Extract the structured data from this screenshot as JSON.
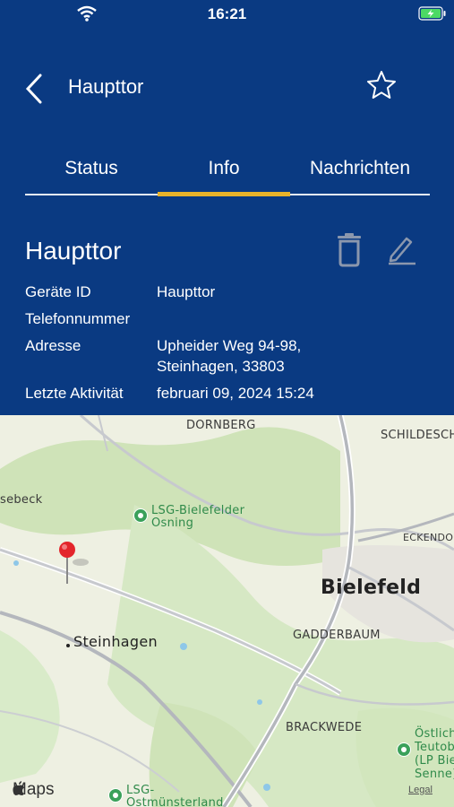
{
  "status_bar": {
    "time": "16:21",
    "icons": [
      "wifi-icon",
      "battery-charging-icon"
    ],
    "battery_color": "#4cd964"
  },
  "header": {
    "title": "Haupttor",
    "back_icon": "chevron-left-icon",
    "favorite_icon": "star-outline-icon"
  },
  "tabs": [
    {
      "label": "Status",
      "active": false
    },
    {
      "label": "Info",
      "active": true
    },
    {
      "label": "Nachrichten",
      "active": false
    }
  ],
  "colors": {
    "primary": "#0a3a82",
    "accent": "#e9b32a"
  },
  "device": {
    "name": "Haupttor",
    "actions": [
      "delete-icon",
      "edit-icon"
    ],
    "fields": [
      {
        "label": "Geräte ID",
        "value": "Haupttor"
      },
      {
        "label": "Telefonnummer",
        "value": ""
      },
      {
        "label": "Adresse",
        "value_line1": "Upheider Weg 94-98,",
        "value_line2": "Steinhagen, 33803"
      },
      {
        "label": "Letzte Aktivität",
        "value": "februari 09, 2024 15:24"
      }
    ]
  },
  "map": {
    "labels": {
      "dornberg": "DORNBERG",
      "schildesche": "SCHILDESCHE",
      "isebeck": "sebeck",
      "lsg_bielefelder_1": "LSG-Bielefelder",
      "lsg_bielefelder_2": "Osning",
      "eckendorf": "ECKENDO",
      "bielefeld": "Bielefeld",
      "steinhagen": "Steinhagen",
      "gadderbaum": "GADDERBAUM",
      "brackwede": "BRACKWEDE",
      "ostlich_1": "Östlich",
      "ostlich_2": "Teutob",
      "ostlich_3": "(LP Bie",
      "ostlich_4": "Senne)",
      "lsg_ost_1": "LSG-",
      "lsg_ost_2": "Ostmünsterland",
      "attribution": "Maps",
      "legal": "Legal"
    },
    "pin_icon": "map-pin-icon"
  }
}
